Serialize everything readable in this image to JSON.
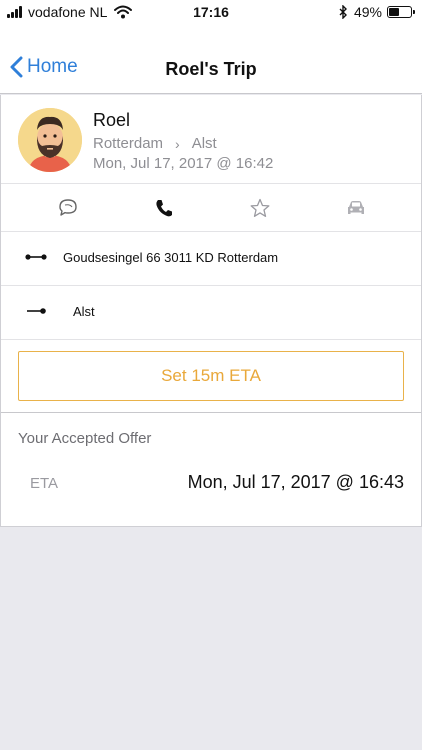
{
  "status_bar": {
    "carrier": "vodafone NL",
    "time": "17:16",
    "battery": "49%",
    "battery_level": 0.49,
    "icons": [
      "signal-icon",
      "wifi-icon",
      "bluetooth-icon",
      "battery-icon"
    ]
  },
  "nav": {
    "back_label": "Home",
    "title": "Roel's Trip"
  },
  "profile": {
    "name": "Roel",
    "origin": "Rotterdam",
    "separator": "›",
    "destination": "Alst",
    "datetime": "Mon, Jul 17, 2017 @ 16:42"
  },
  "actions": [
    "chat-icon",
    "phone-icon",
    "star-icon",
    "car-icon"
  ],
  "addresses": {
    "pickup": "Goudsesingel 66 3011 KD Rotterdam",
    "dropoff": "Alst"
  },
  "eta_button": {
    "label": "Set 15m ETA"
  },
  "offer": {
    "title": "Your Accepted Offer",
    "label": "ETA",
    "value": "Mon, Jul 17, 2017 @ 16:43"
  },
  "colors": {
    "accent_blue": "#2f7fd9",
    "accent_orange": "#e9a83a",
    "background": "#e9e9ee",
    "muted_text": "#8e8e93"
  }
}
